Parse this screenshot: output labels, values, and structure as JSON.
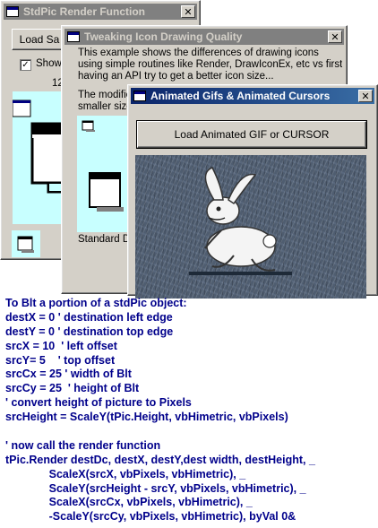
{
  "window_render": {
    "title": "StdPic Render Function",
    "load_button": "Load Sa",
    "show_checkbox": {
      "label": "Show",
      "checked": true
    },
    "partial_value": "12("
  },
  "window_tweak": {
    "title": "Tweaking Icon Drawing Quality",
    "description": [
      "This example shows the differences of drawing icons",
      "using simple routines like Render, DrawIconEx, etc vs first",
      "having an API try to get a better icon size..."
    ],
    "modified_note": [
      "The modifie",
      "smaller size"
    ],
    "standard_label": "Standard D"
  },
  "window_gif": {
    "title": "Animated Gifs & Animated Cursors",
    "load_button": "Load Animated GIF or CURSOR"
  },
  "code_lines": [
    "To Blt a portion of a stdPic object:",
    "destX = 0 ' destination left edge",
    "destY = 0 ' destination top edge",
    "srcX = 10  ' left offset",
    "srcY= 5    ' top offset",
    "srcCx = 25 ' width of Blt",
    "srcCy = 25  ' height of Blt",
    "' convert height of picture to Pixels",
    "srcHeight = ScaleY(tPic.Height, vbHimetric, vbPixels)",
    "",
    "' now call the render function",
    "tPic.Render destDc, destX, destY,dest width, destHeight, _",
    "              ScaleX(srcX, vbPixels, vbHimetric), _",
    "              ScaleY(srcHeight - srcY, vbPixels, vbHimetric), _",
    "              ScaleX(srcCx, vbPixels, vbHimetric), _",
    "              -ScaleY(srcCy, vbPixels, vbHimetric), byVal 0&"
  ],
  "icons": [
    "window-icon",
    "close-icon",
    "folder-window-icon",
    "rabbit-animation"
  ],
  "colors": {
    "code_text": "#00008b",
    "active_title_start": "#0a246a",
    "active_title_end": "#3a6ea5",
    "inactive_title": "#808080",
    "picture_bg": "#c8ffff",
    "animation_bg": "#4f5d70"
  }
}
